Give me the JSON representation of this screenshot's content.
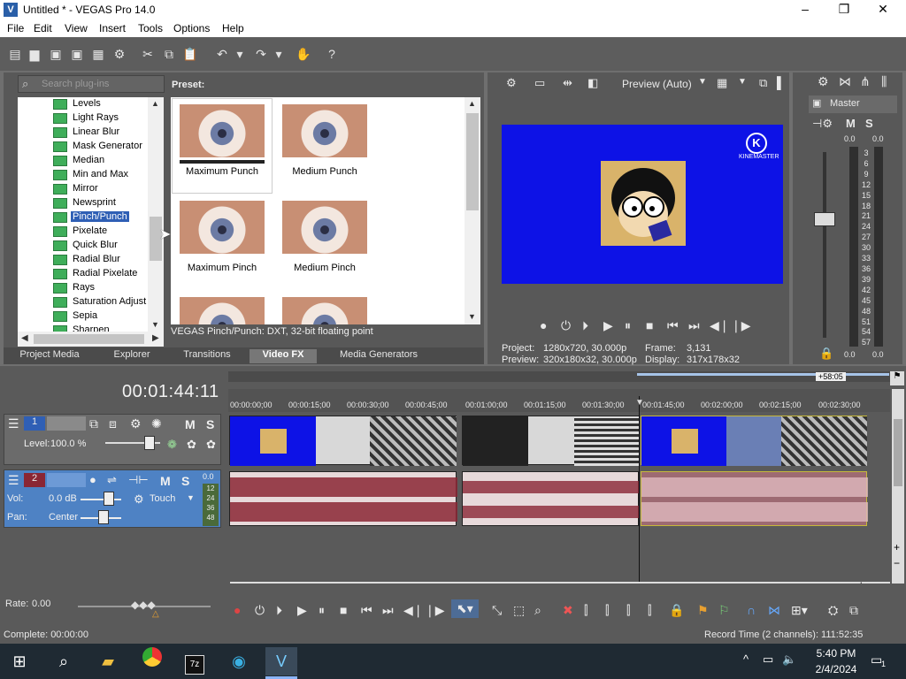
{
  "window": {
    "title": "Untitled * - VEGAS Pro 14.0",
    "app_icon": "vegas-icon"
  },
  "menu": [
    "File",
    "Edit",
    "View",
    "Insert",
    "Tools",
    "Options",
    "Help"
  ],
  "plugins": {
    "search_placeholder": "Search plug-ins",
    "preset_label": "Preset:",
    "items": [
      "Levels",
      "Light Rays",
      "Linear Blur",
      "Mask Generator",
      "Median",
      "Min and Max",
      "Mirror",
      "Newsprint",
      "Pinch/Punch",
      "Pixelate",
      "Quick Blur",
      "Radial Blur",
      "Radial Pixelate",
      "Rays",
      "Saturation Adjust",
      "Sepia",
      "Sharpen"
    ],
    "selected": "Pinch/Punch",
    "presets": [
      "Maximum Punch",
      "Medium Punch",
      "Maximum Pinch",
      "Medium Pinch"
    ],
    "description": "VEGAS Pinch/Punch: DXT, 32-bit floating point"
  },
  "dock_tabs": [
    "Project Media",
    "Explorer",
    "Transitions",
    "Video FX",
    "Media Generators"
  ],
  "active_tab": "Video FX",
  "preview": {
    "mode": "Preview (Auto)",
    "watermark": "KINEMASTER",
    "project_label": "Project:",
    "project": "1280x720, 30.000p",
    "preview_label": "Preview:",
    "preview_res": "320x180x32, 30.000p",
    "frame_label": "Frame:",
    "frame": "3,131",
    "display_label": "Display:",
    "display": "317x178x32"
  },
  "mixer": {
    "title": "Master",
    "solo": "S",
    "mute": "M",
    "left_peak": "0.0",
    "right_peak": "0.0",
    "scale": [
      "3",
      "6",
      "9",
      "12",
      "15",
      "18",
      "21",
      "24",
      "27",
      "30",
      "33",
      "36",
      "39",
      "42",
      "45",
      "48",
      "51",
      "54",
      "57"
    ],
    "bottom_left": "0.0",
    "bottom_right": "0.0"
  },
  "timeline": {
    "time": "00:01:44:11",
    "region_marker": "+58:05",
    "ticks": [
      "00:00:00;00",
      "00:00:15;00",
      "00:00:30;00",
      "00:00:45;00",
      "00:01:00;00",
      "00:01:15;00",
      "00:01:30;00",
      "00:01:45;00",
      "00:02:00;00",
      "00:02:15;00",
      "00:02:30;00"
    ],
    "track1": {
      "number": "1",
      "level_label": "Level:",
      "level": "100.0 %",
      "mute": "M",
      "solo": "S"
    },
    "track2": {
      "number": "2",
      "vol_label": "Vol:",
      "vol": "0.0 dB",
      "pan_label": "Pan:",
      "pan": "Center",
      "automation": "Touch",
      "mute": "M",
      "solo": "S",
      "meter_top": "0.0",
      "meter": [
        "12",
        "24",
        "36",
        "48"
      ]
    }
  },
  "bottom": {
    "rate_label": "Rate:",
    "rate": "0.00",
    "complete": "Complete: 00:00:00",
    "record_time": "Record Time (2 channels): 111:52:35"
  },
  "taskbar": {
    "time": "5:40 PM",
    "date": "2/4/2024",
    "notification": "1",
    "pinned": [
      "file-explorer-icon",
      "chrome-icon",
      "7zip-icon",
      "edge-icon",
      "vegas-icon"
    ]
  }
}
